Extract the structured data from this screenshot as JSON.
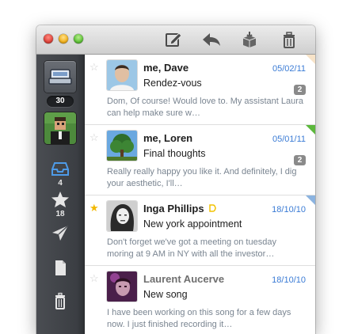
{
  "sidebar": {
    "inbox_account_count": "30",
    "inbox_count": "4",
    "starred_count": "18"
  },
  "messages": [
    {
      "sender": "me, Dave",
      "date": "05/02/11",
      "subject": "Rendez-vous",
      "count": "2",
      "preview": "Dom, Of course! Would love to. My assistant Laura can help make sure w…",
      "starred": false,
      "label_color": "#f7e3c8"
    },
    {
      "sender": "me, Loren",
      "date": "05/01/11",
      "subject": "Final thoughts",
      "count": "2",
      "preview": "Really really happy you like it. And definitely, I dig your aesthetic, I'll…",
      "starred": false,
      "label_color": "#5cb83c"
    },
    {
      "sender": "Inga Phillips",
      "date": "18/10/10",
      "subject": "New york appointment",
      "count": "",
      "preview": "Don't forget we've got a meeting on tuesday moring at 9 AM in NY with all the investor…",
      "starred": true,
      "label_color": "#8bb3e0"
    },
    {
      "sender": "Laurent Aucerve",
      "date": "18/10/10",
      "subject": "New song",
      "count": "",
      "preview": "I have been working on this song for a few days now. I just finished recording it…",
      "starred": false,
      "label_color": ""
    }
  ],
  "colors": {
    "date_blue": "#3a7bd5",
    "preview_grey": "#7a8591",
    "sidebar_dark": "#3b3e43",
    "important_yellow": "#f2c200"
  }
}
